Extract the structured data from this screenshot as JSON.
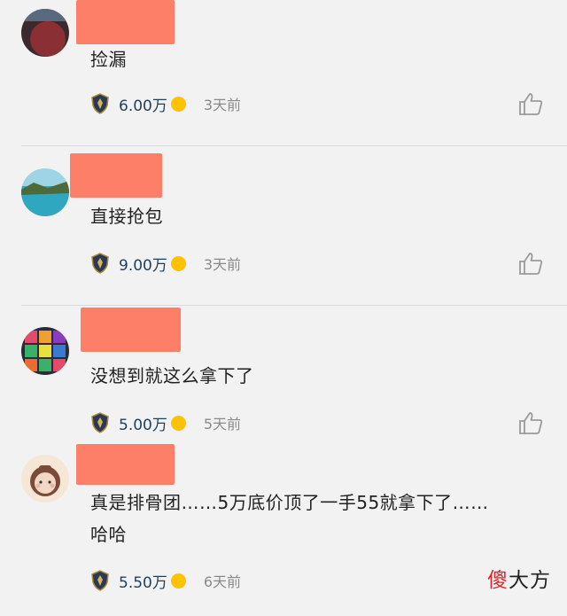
{
  "comments": [
    {
      "text": "捡漏",
      "amount": "6.00万",
      "time": "3天前",
      "avatar_colors": [
        "#3a2a2e",
        "#8a2f34",
        "#5a6a7e"
      ]
    },
    {
      "text": "直接抢包",
      "amount": "9.00万",
      "time": "3天前",
      "avatar_colors": [
        "#9fd3e6",
        "#2fa7c0",
        "#4b6b3a"
      ]
    },
    {
      "text": "没想到就这么拿下了",
      "amount": "5.00万",
      "time": "5天前",
      "avatar_colors": [
        "#e34b6a",
        "#3bb06a",
        "#f0a030"
      ]
    },
    {
      "text_line1": "真是排骨团……5万底价顶了一手55就拿下了……",
      "text_line2": "哈哈",
      "amount": "5.50万",
      "time": "6天前",
      "avatar_colors": [
        "#f6e6d6",
        "#7a4a3a",
        "#e7b7a3"
      ]
    }
  ],
  "watermark": {
    "first": "傻",
    "rest": "大方"
  },
  "icons": {
    "badge": "alliance-crest-icon",
    "coin": "gold-coin-icon",
    "like": "thumbs-up-icon"
  },
  "colors": {
    "redaction": "#fd7f67",
    "coin": "#ffc200",
    "amount": "#1f3f5a"
  }
}
